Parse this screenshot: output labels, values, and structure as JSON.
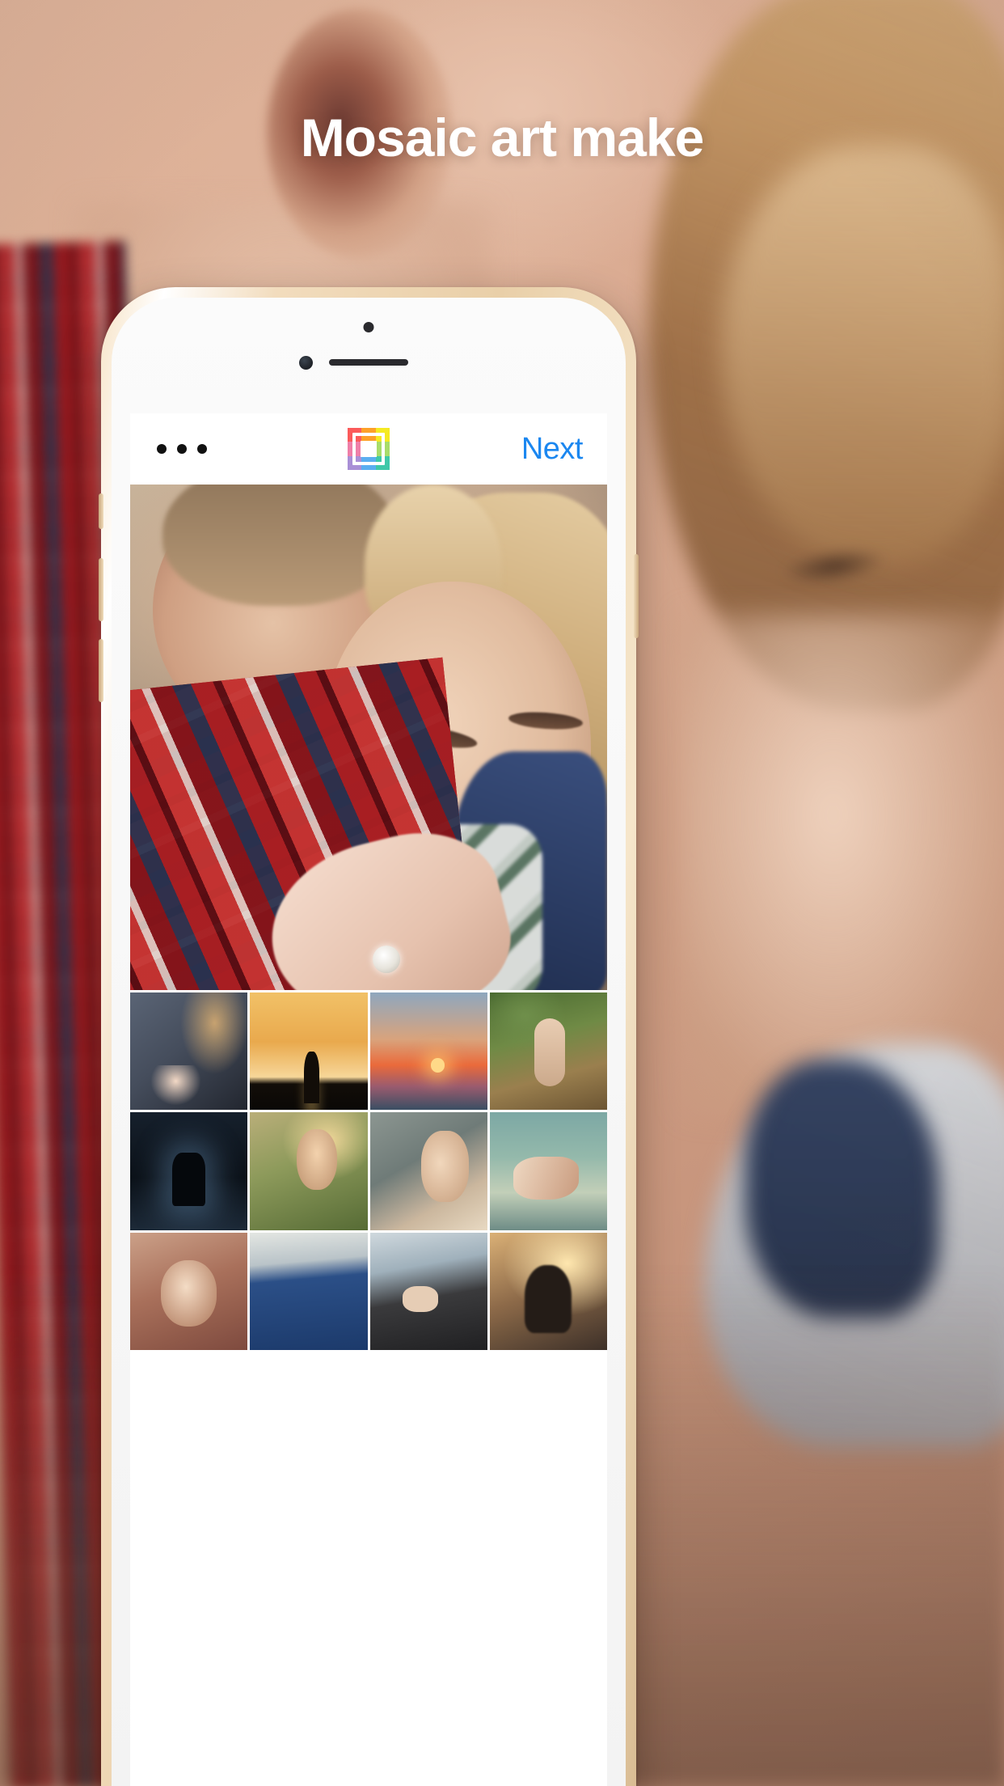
{
  "headline": {
    "text": "Mosaic art make",
    "color": "#ffffff"
  },
  "phone": {
    "frame_color": "#eacfa8",
    "hardware": {
      "speaker_name": "earpiece-speaker",
      "camera_name": "front-camera",
      "sensor_name": "proximity-sensor"
    }
  },
  "app": {
    "navbar": {
      "menu_label": "•••",
      "menu_name": "more-options",
      "logo_name": "mosaic-app-logo",
      "logo_colors": [
        "#fb5a5a",
        "#fda128",
        "#f5ea22",
        "#ef7fa8",
        "#f46d6d",
        "#a8dc6a",
        "#a98fd6",
        "#5aaef0",
        "#3fc8a8"
      ],
      "next_label": "Next",
      "next_color": "#1b87f0"
    },
    "preview": {
      "name": "selected-photo-preview",
      "description": "couple-embracing"
    },
    "gallery": {
      "columns": 4,
      "thumbnails": [
        {
          "id": "thumb-1",
          "description": "woman-in-blazer-with-hand"
        },
        {
          "id": "thumb-2",
          "description": "couple-silhouette-sunset"
        },
        {
          "id": "thumb-3",
          "description": "beach-sunset-couple"
        },
        {
          "id": "thumb-4",
          "description": "legs-on-forest-path"
        },
        {
          "id": "thumb-5",
          "description": "couple-dancing-night-rain"
        },
        {
          "id": "thumb-6",
          "description": "couple-in-tall-grass"
        },
        {
          "id": "thumb-7",
          "description": "couple-kissing-close-up"
        },
        {
          "id": "thumb-8",
          "description": "hands-holding-wine-over-water"
        },
        {
          "id": "thumb-9",
          "description": "couple-portrait-warm"
        },
        {
          "id": "thumb-10",
          "description": "person-in-blue-skirt"
        },
        {
          "id": "thumb-11",
          "description": "man-wrist-watch-leather"
        },
        {
          "id": "thumb-12",
          "description": "silhouette-golden-hour"
        }
      ]
    }
  }
}
